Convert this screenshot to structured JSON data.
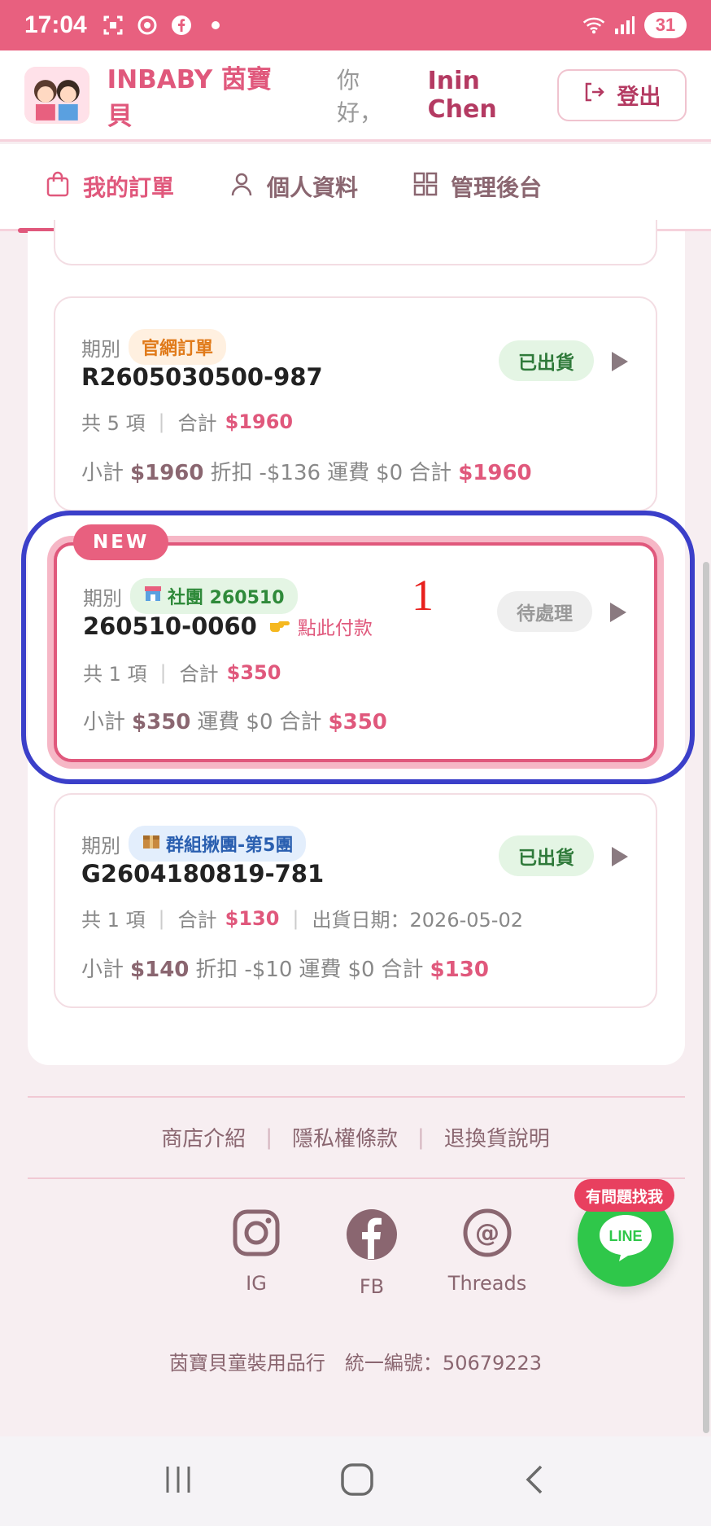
{
  "status_bar": {
    "time": "17:04",
    "battery": "31"
  },
  "header": {
    "brand": "INBABY 茵寶貝",
    "greeting": "你好，",
    "username": "Inin Chen",
    "logout_label": "登出"
  },
  "tabs": [
    {
      "label": "我的訂單",
      "icon": "bag-icon",
      "active": true
    },
    {
      "label": "個人資料",
      "icon": "user-icon",
      "active": false
    },
    {
      "label": "管理後台",
      "icon": "grid-icon",
      "active": false
    }
  ],
  "orders": [
    {
      "period_label": "期別",
      "badge": "官網訂單",
      "order_no": "R2605030500-987",
      "count": "共 5 項",
      "total_label": "合計",
      "total": "$1960",
      "status": "已出貨",
      "subtotal_label": "小計",
      "subtotal": "$1960",
      "discount_label": "折扣",
      "discount": "-$136",
      "shipping_label": "運費",
      "shipping": "$0",
      "grand_label": "合計",
      "grand": "$1960"
    },
    {
      "new_tag": "NEW",
      "period_label": "期別",
      "badge": "社團 260510",
      "order_no": "260510-0060",
      "pay_link": "點此付款",
      "count": "共 1 項",
      "total_label": "合計",
      "total": "$350",
      "status": "待處理",
      "subtotal_label": "小計",
      "subtotal": "$350",
      "shipping_label": "運費",
      "shipping": "$0",
      "grand_label": "合計",
      "grand": "$350"
    },
    {
      "period_label": "期別",
      "badge": "群組揪團-第5團",
      "order_no": "G2604180819-781",
      "count": "共 1 項",
      "total_label": "合計",
      "total": "$130",
      "ship_date": "出貨日期：2026-05-02",
      "status": "已出貨",
      "subtotal_label": "小計",
      "subtotal": "$140",
      "discount_label": "折扣",
      "discount": "-$10",
      "shipping_label": "運費",
      "shipping": "$0",
      "grand_label": "合計",
      "grand": "$130"
    }
  ],
  "annotation": "1",
  "footer": {
    "links": [
      "商店介紹",
      "隱私權條款",
      "退換貨說明"
    ],
    "socials": [
      "IG",
      "FB",
      "Threads"
    ],
    "company": "茵寶貝童裝用品行　統一編號：50679223",
    "help_tip": "有問題找我",
    "line_label": "LINE"
  },
  "colors": {
    "accent": "#e0587c",
    "status_bar": "#e8607f",
    "annotation_ring": "#3b3fc9",
    "line_green": "#2fc74a"
  }
}
